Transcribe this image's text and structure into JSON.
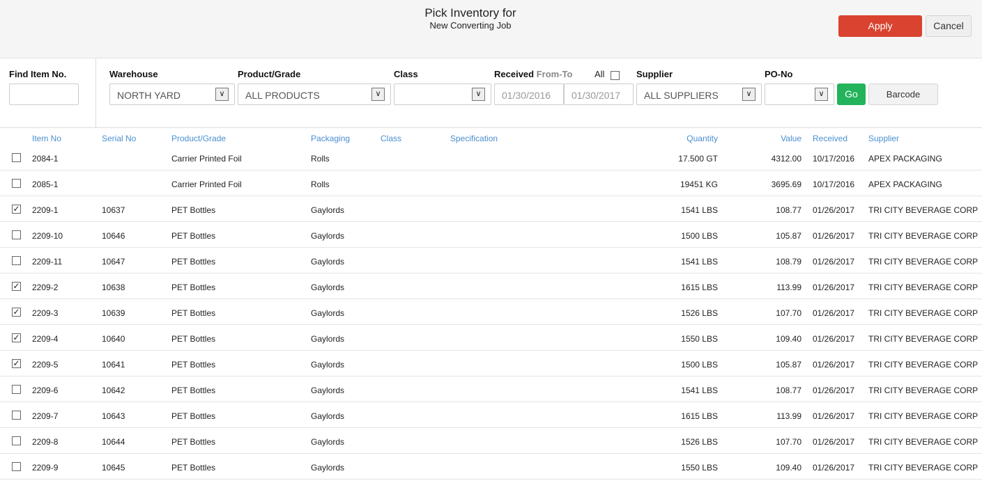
{
  "header": {
    "title": "Pick Inventory for",
    "subtitle": "New Converting Job",
    "apply": "Apply",
    "cancel": "Cancel"
  },
  "filters": {
    "find_label": "Find Item No.",
    "find_value": "",
    "warehouse_label": "Warehouse",
    "warehouse_value": "NORTH YARD",
    "product_label": "Product/Grade",
    "product_value": "ALL PRODUCTS",
    "class_label": "Class",
    "class_value": "",
    "received_label": "Received",
    "from_to": "From-To",
    "all_label": "All",
    "all_checked": false,
    "date_from": "01/30/2016",
    "date_to": "01/30/2017",
    "supplier_label": "Supplier",
    "supplier_value": "ALL SUPPLIERS",
    "po_label": "PO-No",
    "po_value": "",
    "go": "Go",
    "barcode": "Barcode"
  },
  "columns": {
    "item": "Item No",
    "serial": "Serial No",
    "product": "Product/Grade",
    "packaging": "Packaging",
    "class": "Class",
    "spec": "Specification",
    "quantity": "Quantity",
    "value": "Value",
    "received": "Received",
    "supplier": "Supplier"
  },
  "rows": [
    {
      "checked": false,
      "item": "2084-1",
      "serial": "",
      "product": "Carrier Printed Foil",
      "packaging": "Rolls",
      "class": "",
      "spec": "",
      "quantity": "17.500 GT",
      "value": "4312.00",
      "received": "10/17/2016",
      "supplier": "APEX PACKAGING"
    },
    {
      "checked": false,
      "item": "2085-1",
      "serial": "",
      "product": "Carrier Printed Foil",
      "packaging": "Rolls",
      "class": "",
      "spec": "",
      "quantity": "19451 KG",
      "value": "3695.69",
      "received": "10/17/2016",
      "supplier": "APEX PACKAGING"
    },
    {
      "checked": true,
      "item": "2209-1",
      "serial": "10637",
      "product": "PET Bottles",
      "packaging": "Gaylords",
      "class": "",
      "spec": "",
      "quantity": "1541 LBS",
      "value": "108.77",
      "received": "01/26/2017",
      "supplier": "TRI CITY BEVERAGE CORP"
    },
    {
      "checked": false,
      "item": "2209-10",
      "serial": "10646",
      "product": "PET Bottles",
      "packaging": "Gaylords",
      "class": "",
      "spec": "",
      "quantity": "1500 LBS",
      "value": "105.87",
      "received": "01/26/2017",
      "supplier": "TRI CITY BEVERAGE CORP"
    },
    {
      "checked": false,
      "item": "2209-11",
      "serial": "10647",
      "product": "PET Bottles",
      "packaging": "Gaylords",
      "class": "",
      "spec": "",
      "quantity": "1541 LBS",
      "value": "108.79",
      "received": "01/26/2017",
      "supplier": "TRI CITY BEVERAGE CORP"
    },
    {
      "checked": true,
      "item": "2209-2",
      "serial": "10638",
      "product": "PET Bottles",
      "packaging": "Gaylords",
      "class": "",
      "spec": "",
      "quantity": "1615 LBS",
      "value": "113.99",
      "received": "01/26/2017",
      "supplier": "TRI CITY BEVERAGE CORP"
    },
    {
      "checked": true,
      "item": "2209-3",
      "serial": "10639",
      "product": "PET Bottles",
      "packaging": "Gaylords",
      "class": "",
      "spec": "",
      "quantity": "1526 LBS",
      "value": "107.70",
      "received": "01/26/2017",
      "supplier": "TRI CITY BEVERAGE CORP"
    },
    {
      "checked": true,
      "item": "2209-4",
      "serial": "10640",
      "product": "PET Bottles",
      "packaging": "Gaylords",
      "class": "",
      "spec": "",
      "quantity": "1550 LBS",
      "value": "109.40",
      "received": "01/26/2017",
      "supplier": "TRI CITY BEVERAGE CORP"
    },
    {
      "checked": true,
      "item": "2209-5",
      "serial": "10641",
      "product": "PET Bottles",
      "packaging": "Gaylords",
      "class": "",
      "spec": "",
      "quantity": "1500 LBS",
      "value": "105.87",
      "received": "01/26/2017",
      "supplier": "TRI CITY BEVERAGE CORP"
    },
    {
      "checked": false,
      "item": "2209-6",
      "serial": "10642",
      "product": "PET Bottles",
      "packaging": "Gaylords",
      "class": "",
      "spec": "",
      "quantity": "1541 LBS",
      "value": "108.77",
      "received": "01/26/2017",
      "supplier": "TRI CITY BEVERAGE CORP"
    },
    {
      "checked": false,
      "item": "2209-7",
      "serial": "10643",
      "product": "PET Bottles",
      "packaging": "Gaylords",
      "class": "",
      "spec": "",
      "quantity": "1615 LBS",
      "value": "113.99",
      "received": "01/26/2017",
      "supplier": "TRI CITY BEVERAGE CORP"
    },
    {
      "checked": false,
      "item": "2209-8",
      "serial": "10644",
      "product": "PET Bottles",
      "packaging": "Gaylords",
      "class": "",
      "spec": "",
      "quantity": "1526 LBS",
      "value": "107.70",
      "received": "01/26/2017",
      "supplier": "TRI CITY BEVERAGE CORP"
    },
    {
      "checked": false,
      "item": "2209-9",
      "serial": "10645",
      "product": "PET Bottles",
      "packaging": "Gaylords",
      "class": "",
      "spec": "",
      "quantity": "1550 LBS",
      "value": "109.40",
      "received": "01/26/2017",
      "supplier": "TRI CITY BEVERAGE CORP"
    }
  ]
}
